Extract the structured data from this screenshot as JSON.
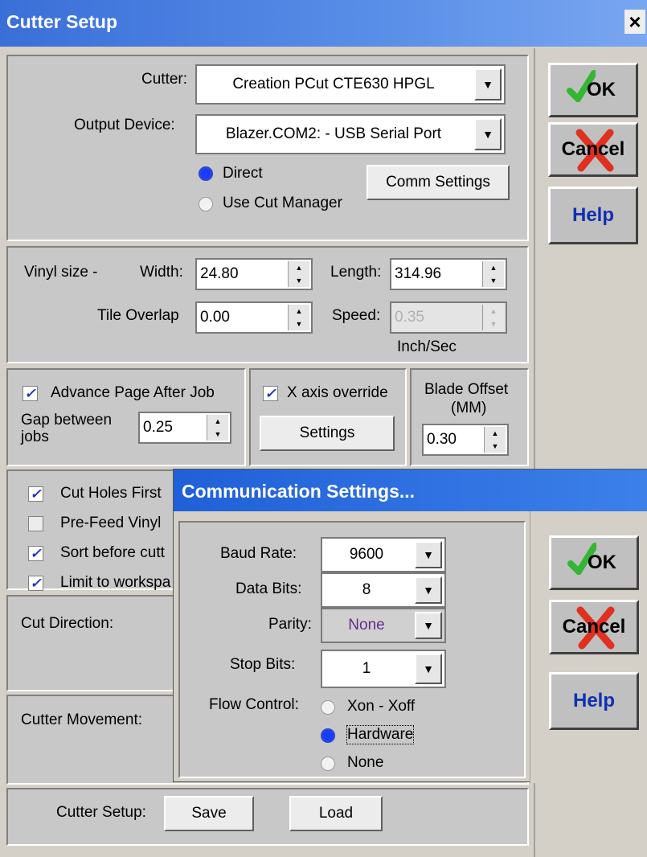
{
  "window": {
    "title": "Cutter Setup",
    "close": "×"
  },
  "cutter": {
    "label": "Cutter:",
    "value": "Creation PCut CTE630 HPGL",
    "output_label": "Output Device:",
    "output_value": "Blazer.COM2: - USB Serial Port",
    "direct_label": "Direct",
    "cut_manager_label": "Use Cut Manager",
    "mode_selected": "Direct",
    "comm_settings_label": "Comm Settings"
  },
  "vinyl": {
    "size_label": "Vinyl size -",
    "width_label": "Width:",
    "width_value": "24.80",
    "length_label": "Length:",
    "length_value": "314.96",
    "tile_label": "Tile Overlap",
    "tile_value": "0.00",
    "speed_label": "Speed:",
    "speed_value": "0.35",
    "speed_unit": "Inch/Sec"
  },
  "page": {
    "advance_label": "Advance Page After Job",
    "advance_checked": true,
    "gap_label_1": "Gap between",
    "gap_label_2": "jobs",
    "gap_value": "0.25",
    "x_axis_label": "X axis override",
    "x_axis_checked": true,
    "settings_label": "Settings",
    "blade_label_1": "Blade Offset",
    "blade_label_2": "(MM)",
    "blade_value": "0.30"
  },
  "options": {
    "cut_holes": "Cut Holes First",
    "pre_feed": "Pre-Feed Vinyl",
    "sort": "Sort before cutt",
    "limit": "Limit to workspa",
    "cut_direction": "Cut Direction:",
    "cutter_movement": "Cutter Movement:"
  },
  "setup": {
    "label": "Cutter Setup:",
    "save": "Save",
    "load": "Load"
  },
  "buttons": {
    "ok": "OK",
    "cancel": "Cancel",
    "help": "Help"
  },
  "comm": {
    "title": "Communication Settings...",
    "baud_label": "Baud Rate:",
    "baud_value": "9600",
    "data_label": "Data Bits:",
    "data_value": "8",
    "parity_label": "Parity:",
    "parity_value": "None",
    "stop_label": "Stop Bits:",
    "stop_value": "1",
    "flow_label": "Flow Control:",
    "flow_xon": "Xon - Xoff",
    "flow_hw": "Hardware",
    "flow_none": "None",
    "flow_selected": "Hardware",
    "ok": "OK",
    "cancel": "Cancel",
    "help": "Help"
  },
  "colors": {
    "title_blue": "#3a6fd8",
    "help_text": "#1030b0",
    "ok_check": "#34b534",
    "cancel_x": "#e03020",
    "parity_text": "#6a2a8a"
  },
  "icons": {
    "ok": "checkmark-icon",
    "cancel": "red-x-icon",
    "dropdown": "chevron-down-icon"
  }
}
